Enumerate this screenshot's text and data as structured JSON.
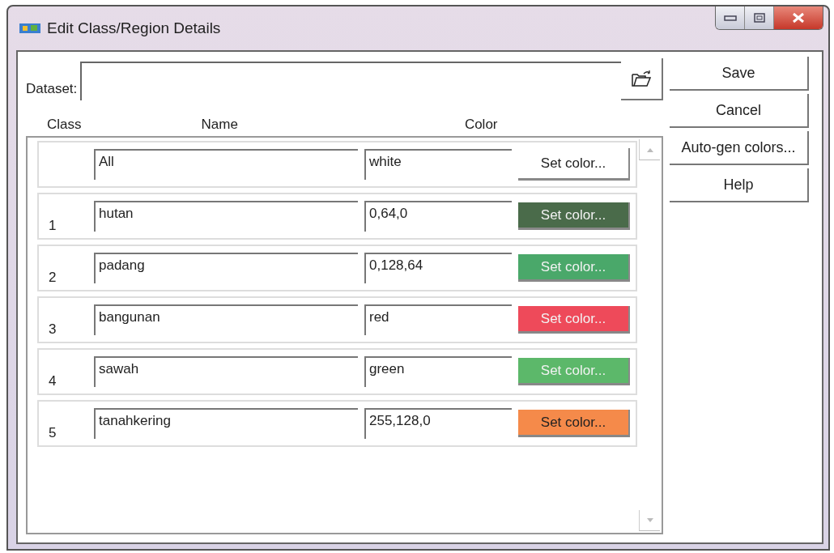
{
  "window": {
    "title": "Edit Class/Region Details"
  },
  "dataset": {
    "label": "Dataset:"
  },
  "columns": [
    "Class",
    "Name",
    "Color"
  ],
  "rows": [
    {
      "kind": "all",
      "class": "",
      "name": "All",
      "value": "white",
      "button": "Set color..."
    },
    {
      "kind": "class",
      "class": "1",
      "name": "hutan",
      "value": "0,64,0",
      "button": "Set color...",
      "color": "#4a6b4a"
    },
    {
      "kind": "class",
      "class": "2",
      "name": "padang",
      "value": "0,128,64",
      "button": "Set color...",
      "color": "#4aa86a"
    },
    {
      "kind": "class",
      "class": "3",
      "name": "bangunan",
      "value": "red",
      "button": "Set color...",
      "color": "#ee4a5a"
    },
    {
      "kind": "class",
      "class": "4",
      "name": "sawah",
      "value": "green",
      "button": "Set color...",
      "color": "#5cb86a"
    },
    {
      "kind": "class",
      "class": "5",
      "name": "tanahkering",
      "value": "255,128,0",
      "button": "Set color...",
      "color": "#f58a4a"
    }
  ],
  "buttons": [
    "Save",
    "Cancel",
    "Auto-gen colors...",
    "Help"
  ]
}
